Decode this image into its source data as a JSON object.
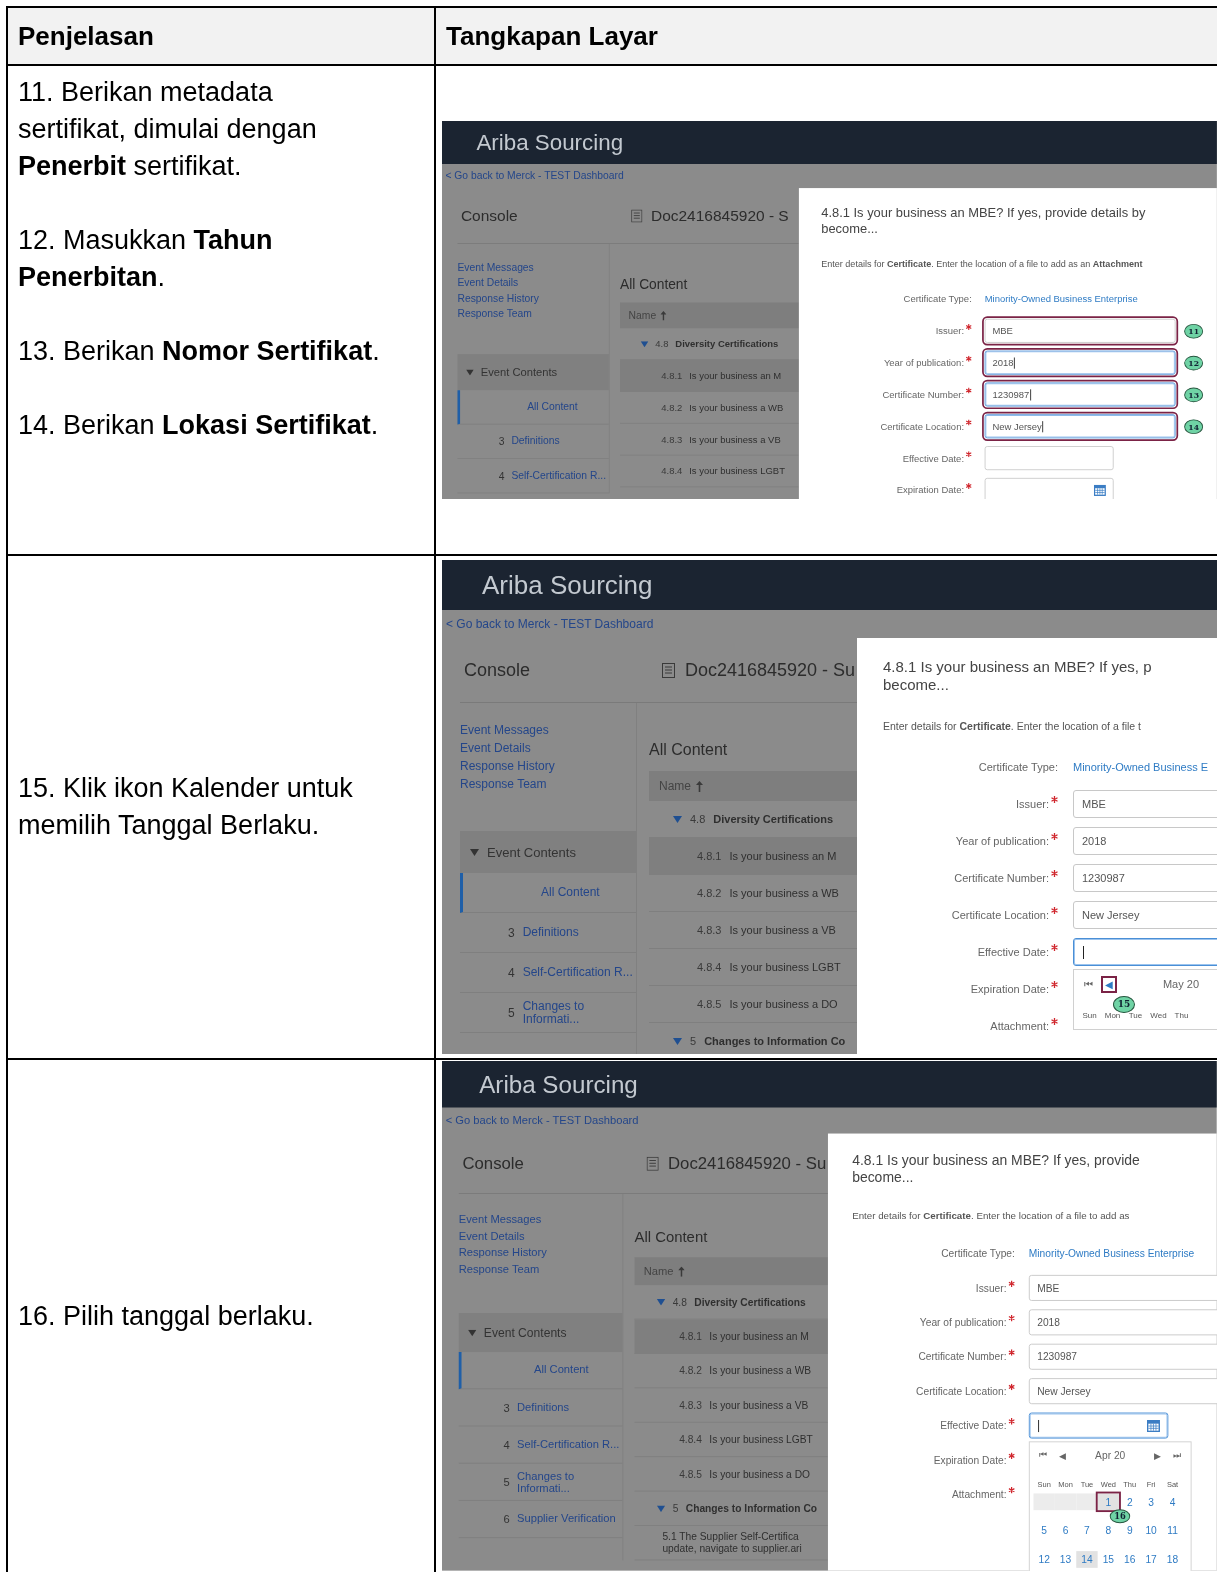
{
  "table": {
    "columns": [
      "Penjelasan",
      "Tangkapan Layar"
    ],
    "rows": [
      {
        "instructions": [
          "11. Berikan metadata sertifikat, dimulai dengan **Penerbit** sertifikat.",
          "12. Masukkan **Tahun Penerbitan**.",
          "13. Berikan **Nomor Sertifikat**.",
          "14. Berikan **Lokasi Sertifikat**."
        ],
        "screenshot": {
          "app_title": "Ariba Sourcing",
          "back_link": "< Go back to Merck - TEST Dashboard",
          "console_title": "Console",
          "document_title": "Doc2416845920 - S",
          "sidebar_links": [
            "Event Messages",
            "Event Details",
            "Response History",
            "Response Team"
          ],
          "event_contents": {
            "label": "Event Contents",
            "expanded": true
          },
          "nav_items": [
            {
              "label": "All Content",
              "selected": true
            },
            {
              "number": "3",
              "label": "Definitions",
              "selected": false
            },
            {
              "number": "4",
              "label": "Self-Certification R...",
              "selected": false
            }
          ],
          "content_title": "All Content",
          "name_column": "Name",
          "tree": [
            {
              "kind": "section",
              "number": "4.8",
              "label": "Diversity Certifications",
              "expanded": true,
              "selected": false
            },
            {
              "kind": "item",
              "number": "4.8.1",
              "label": "Is your business an M",
              "selected": true
            },
            {
              "kind": "item",
              "number": "4.8.2",
              "label": "Is your business a WB",
              "selected": false
            },
            {
              "kind": "item",
              "number": "4.8.3",
              "label": "Is your business a VB",
              "selected": false
            },
            {
              "kind": "item",
              "number": "4.8.4",
              "label": "Is your business LGBT",
              "selected": false
            }
          ],
          "dialog": {
            "question_lines": [
              "4.8.1 Is your business an MBE? If yes, provide details by",
              "become..."
            ],
            "instruction": "Enter details for **Certificate**. Enter the location of a file to add as an **Attachment**",
            "fields": [
              {
                "kind": "link",
                "label": "Certificate Type:",
                "value": "Minority-Owned Business Enterprise"
              },
              {
                "kind": "text",
                "label": "Issuer:",
                "value": "MBE",
                "required": true,
                "focused": false,
                "callout": "11"
              },
              {
                "kind": "text",
                "label": "Year of publication:",
                "value": "2018",
                "required": true,
                "focused": true,
                "callout": "12"
              },
              {
                "kind": "text",
                "label": "Certificate Number:",
                "value": "1230987",
                "required": true,
                "focused": true,
                "callout": "13"
              },
              {
                "kind": "text",
                "label": "Certificate Location:",
                "value": "New Jersey",
                "required": true,
                "focused": true,
                "callout": "14"
              },
              {
                "kind": "date",
                "label": "Effective Date:",
                "required": true,
                "focused": false,
                "calendar_icon": false
              },
              {
                "kind": "date",
                "label": "Expiration Date:",
                "required": true,
                "focused": false,
                "calendar_icon": true
              }
            ]
          }
        }
      },
      {
        "instructions": [
          "15. Klik ikon Kalender untuk memilih Tanggal Berlaku."
        ],
        "screenshot": {
          "app_title": "Ariba Sourcing",
          "back_link": "< Go back to Merck - TEST Dashboard",
          "console_title": "Console",
          "document_title": "Doc2416845920 - Su",
          "sidebar_links": [
            "Event Messages",
            "Event Details",
            "Response History",
            "Response Team"
          ],
          "event_contents": {
            "label": "Event Contents",
            "expanded": true
          },
          "nav_items": [
            {
              "label": "All Content",
              "selected": true
            },
            {
              "number": "3",
              "label": "Definitions",
              "selected": false
            },
            {
              "number": "4",
              "label": "Self-Certification R...",
              "selected": false
            },
            {
              "number": "5",
              "label": "Changes to Informati...",
              "selected": false
            }
          ],
          "content_title": "All Content",
          "name_column": "Name",
          "tree": [
            {
              "kind": "section",
              "number": "4.8",
              "label": "Diversity Certifications",
              "expanded": true,
              "selected": false
            },
            {
              "kind": "item",
              "number": "4.8.1",
              "label": "Is your business an M",
              "selected": true
            },
            {
              "kind": "item",
              "number": "4.8.2",
              "label": "Is your business a WB",
              "selected": false
            },
            {
              "kind": "item",
              "number": "4.8.3",
              "label": "Is your business a VB",
              "selected": false
            },
            {
              "kind": "item",
              "number": "4.8.4",
              "label": "Is your business LGBT",
              "selected": false
            },
            {
              "kind": "item",
              "number": "4.8.5",
              "label": "Is your business a DO",
              "selected": false
            },
            {
              "kind": "section",
              "number": "5",
              "label": "Changes to Information Co",
              "expanded": true,
              "selected": false
            }
          ],
          "dialog": {
            "question_lines": [
              "4.8.1 Is your business an MBE? If yes, p",
              "become..."
            ],
            "instruction": "Enter details for **Certificate**. Enter the location of a file t",
            "fields": [
              {
                "kind": "link",
                "label": "Certificate Type:",
                "value": "Minority-Owned Business E"
              },
              {
                "kind": "text",
                "label": "Issuer:",
                "value": "MBE",
                "required": true,
                "focused": false
              },
              {
                "kind": "text",
                "label": "Year of publication:",
                "value": "2018",
                "required": true,
                "focused": false
              },
              {
                "kind": "text",
                "label": "Certificate Number:",
                "value": "1230987",
                "required": true,
                "focused": false
              },
              {
                "kind": "text",
                "label": "Certificate Location:",
                "value": "New Jersey",
                "required": true,
                "focused": false
              },
              {
                "kind": "date",
                "label": "Effective Date:",
                "required": true,
                "focused": true,
                "calendar_icon": false,
                "calendar": {
                  "nav_before": [
                    {
                      "glyph": "⏮"
                    },
                    {
                      "glyph": "◀",
                      "callout": "15"
                    }
                  ],
                  "month": "May 20",
                  "weekdays": [
                    "Sun",
                    "Mon",
                    "Tue",
                    "Wed",
                    "Thu"
                  ]
                }
              },
              {
                "kind": "label_only",
                "label": "Expiration Date:",
                "required": true
              },
              {
                "kind": "label_only",
                "label": "Attachment:",
                "required": true
              }
            ]
          }
        }
      },
      {
        "instructions": [
          "16. Pilih tanggal berlaku."
        ],
        "screenshot": {
          "app_title": "Ariba Sourcing",
          "back_link": "< Go back to Merck - TEST Dashboard",
          "console_title": "Console",
          "document_title": "Doc2416845920 - Su",
          "sidebar_links": [
            "Event Messages",
            "Event Details",
            "Response History",
            "Response Team"
          ],
          "event_contents": {
            "label": "Event Contents",
            "expanded": true
          },
          "nav_items": [
            {
              "label": "All Content",
              "selected": true
            },
            {
              "number": "3",
              "label": "Definitions",
              "selected": false
            },
            {
              "number": "4",
              "label": "Self-Certification R...",
              "selected": false
            },
            {
              "number": "5",
              "label": "Changes to Informati...",
              "selected": false
            },
            {
              "number": "6",
              "label": "Supplier Verification",
              "selected": false
            }
          ],
          "content_title": "All Content",
          "name_column": "Name",
          "tree": [
            {
              "kind": "section",
              "number": "4.8",
              "label": "Diversity Certifications",
              "expanded": true,
              "selected": false
            },
            {
              "kind": "item",
              "number": "4.8.1",
              "label": "Is your business an M",
              "selected": true
            },
            {
              "kind": "item",
              "number": "4.8.2",
              "label": "Is your business a WB",
              "selected": false
            },
            {
              "kind": "item",
              "number": "4.8.3",
              "label": "Is your business a VB",
              "selected": false
            },
            {
              "kind": "item",
              "number": "4.8.4",
              "label": "Is your business LGBT",
              "selected": false
            },
            {
              "kind": "item",
              "number": "4.8.5",
              "label": "Is your business a DO",
              "selected": false
            },
            {
              "kind": "section",
              "number": "5",
              "label": "Changes to Information Co",
              "expanded": true,
              "selected": false
            },
            {
              "kind": "note",
              "lines": [
                "5.1  The Supplier Self-Certifica",
                "update, navigate to supplier.ari"
              ],
              "selected": false
            }
          ],
          "dialog": {
            "question_lines": [
              "4.8.1 Is your business an MBE? If yes, provide",
              "become..."
            ],
            "instruction": "Enter details for **Certificate**. Enter the location of a file to add as",
            "fields": [
              {
                "kind": "link",
                "label": "Certificate Type:",
                "value": "Minority-Owned Business Enterprise"
              },
              {
                "kind": "text",
                "label": "Issuer:",
                "value": "MBE",
                "required": true,
                "focused": false
              },
              {
                "kind": "text",
                "label": "Year of publication:",
                "value": "2018",
                "required": true,
                "focused": false
              },
              {
                "kind": "text",
                "label": "Certificate Number:",
                "value": "1230987",
                "required": true,
                "focused": false
              },
              {
                "kind": "text",
                "label": "Certificate Location:",
                "value": "New Jersey",
                "required": true,
                "focused": false
              },
              {
                "kind": "date",
                "label": "Effective Date:",
                "required": true,
                "focused": true,
                "calendar_icon": true,
                "calendar": {
                  "nav_before": [
                    {
                      "glyph": "⏮"
                    },
                    {
                      "glyph": "◀"
                    }
                  ],
                  "month": "Apr 20",
                  "nav_after": [
                    {
                      "glyph": "▶"
                    },
                    {
                      "glyph": "⏭"
                    }
                  ],
                  "weekdays": [
                    "Sun",
                    "Mon",
                    "Tue",
                    "Wed",
                    "Thu",
                    "Fri",
                    "Sat"
                  ],
                  "weeks": [
                    [
                      {
                        "kind": "blank"
                      },
                      {
                        "kind": "blank"
                      },
                      {
                        "kind": "blank"
                      },
                      {
                        "kind": "day",
                        "day": "1",
                        "highlighted": true,
                        "callout": "16"
                      },
                      {
                        "kind": "day",
                        "day": "2",
                        "highlighted": false
                      },
                      {
                        "kind": "day",
                        "day": "3",
                        "highlighted": false
                      },
                      {
                        "kind": "day",
                        "day": "4",
                        "highlighted": false
                      }
                    ],
                    [
                      {
                        "kind": "day",
                        "day": "5",
                        "highlighted": false
                      },
                      {
                        "kind": "day",
                        "day": "6",
                        "highlighted": false
                      },
                      {
                        "kind": "day",
                        "day": "7",
                        "highlighted": false
                      },
                      {
                        "kind": "day",
                        "day": "8",
                        "highlighted": false
                      },
                      {
                        "kind": "day",
                        "day": "9",
                        "highlighted": false
                      },
                      {
                        "kind": "day",
                        "day": "10",
                        "highlighted": false
                      },
                      {
                        "kind": "day",
                        "day": "11",
                        "highlighted": false
                      }
                    ],
                    [
                      {
                        "kind": "day",
                        "day": "12",
                        "highlighted": false
                      },
                      {
                        "kind": "day",
                        "day": "13",
                        "highlighted": false
                      },
                      {
                        "kind": "day",
                        "day": "14",
                        "highlighted": true
                      },
                      {
                        "kind": "day",
                        "day": "15",
                        "highlighted": false
                      },
                      {
                        "kind": "day",
                        "day": "16",
                        "highlighted": false
                      },
                      {
                        "kind": "day",
                        "day": "17",
                        "highlighted": false
                      },
                      {
                        "kind": "day",
                        "day": "18",
                        "highlighted": false
                      }
                    ]
                  ]
                }
              },
              {
                "kind": "label_only",
                "label": "Expiration Date:",
                "required": true
              },
              {
                "kind": "label_only",
                "label": "Attachment:",
                "required": true
              }
            ]
          }
        }
      }
    ]
  }
}
